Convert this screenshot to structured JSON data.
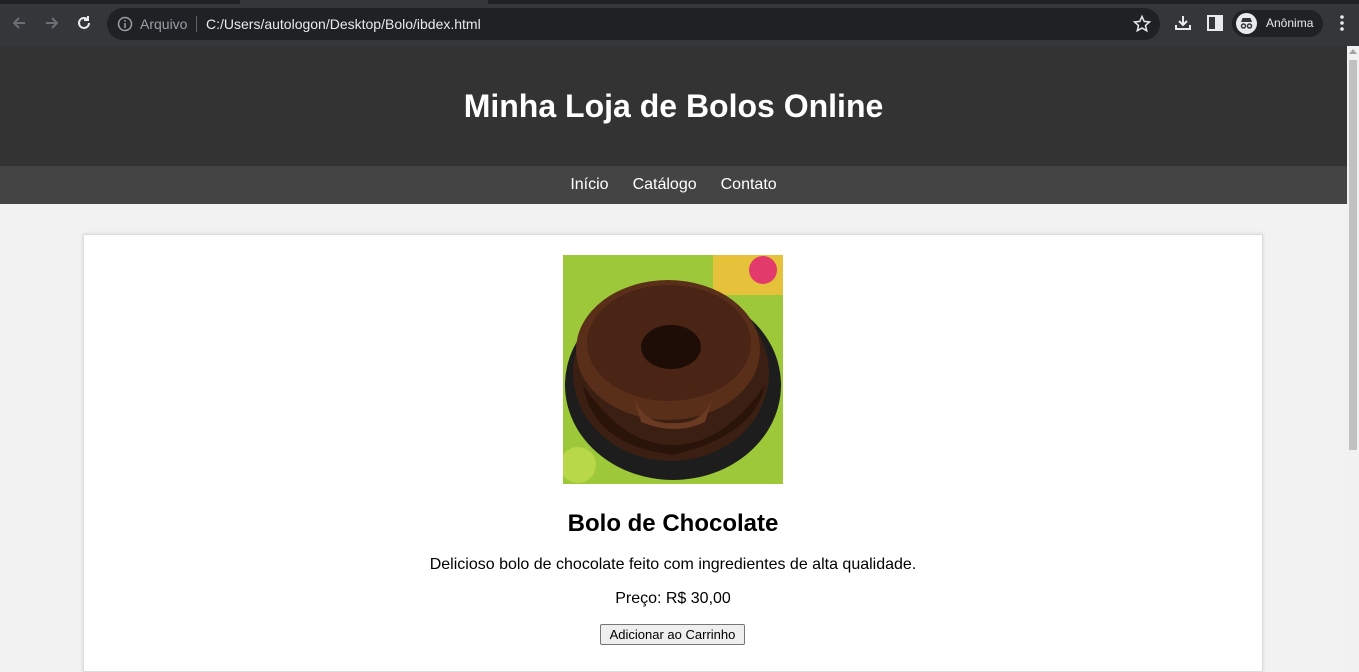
{
  "browser": {
    "scheme_label": "Arquivo",
    "url": "C:/Users/autologon/Desktop/Bolo/ibdex.html",
    "profile_name": "Anônima"
  },
  "header": {
    "title": "Minha Loja de Bolos Online"
  },
  "nav": {
    "items": [
      {
        "label": "Início"
      },
      {
        "label": "Catálogo"
      },
      {
        "label": "Contato"
      }
    ]
  },
  "product": {
    "name": "Bolo de Chocolate",
    "description": "Delicioso bolo de chocolate feito com ingredientes de alta qualidade.",
    "price": "Preço: R$ 30,00",
    "button_label": "Adicionar ao Carrinho"
  },
  "colors": {
    "header_bg": "#333333",
    "nav_bg": "#444444",
    "page_bg": "#f2f2f2"
  }
}
